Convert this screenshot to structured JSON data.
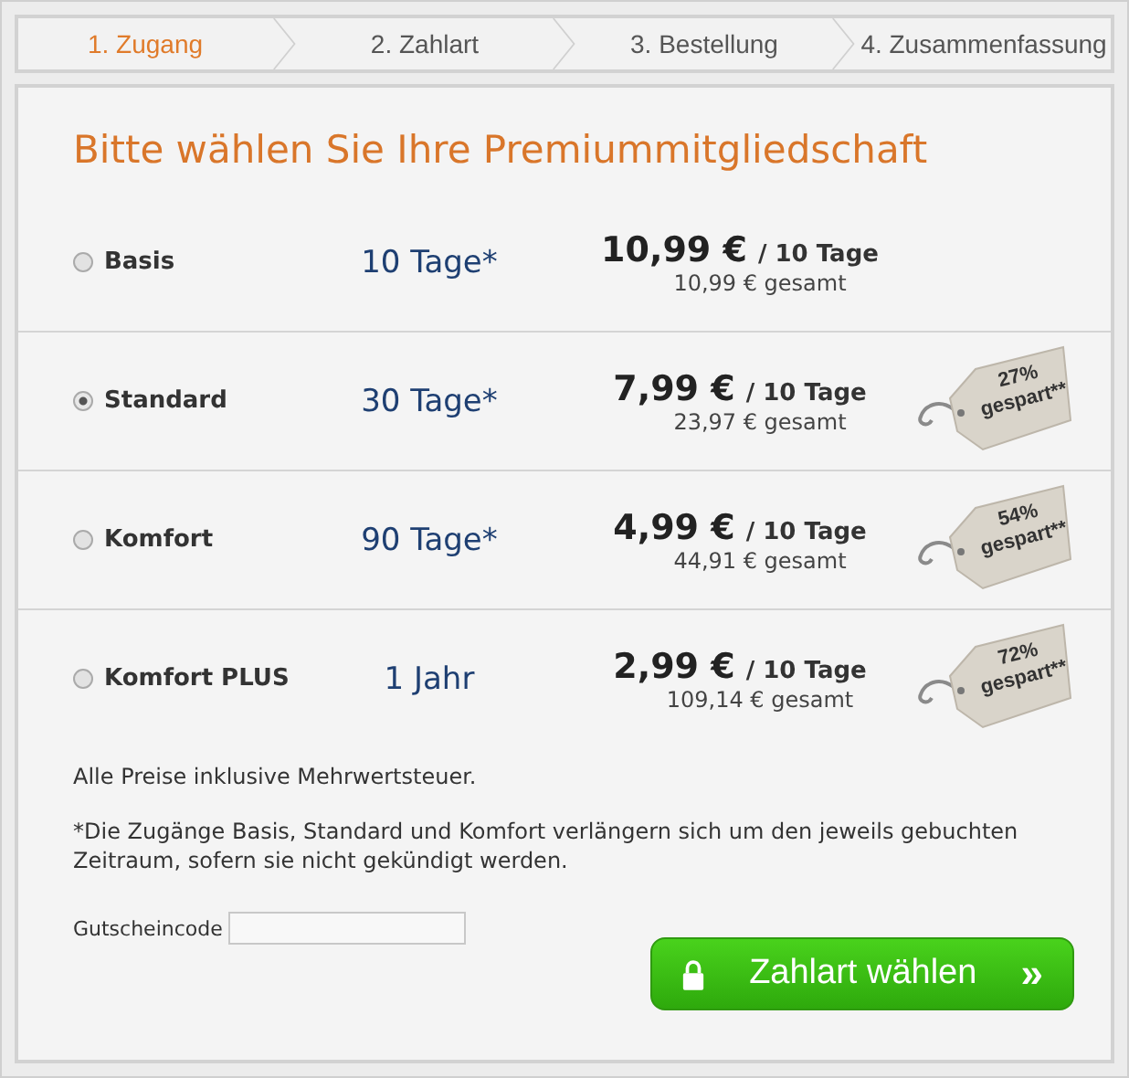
{
  "steps": [
    {
      "label": "1. Zugang",
      "selected": true
    },
    {
      "label": "2. Zahlart",
      "selected": false
    },
    {
      "label": "3. Bestellung",
      "selected": false
    },
    {
      "label": "4. Zusammenfassung",
      "selected": false
    }
  ],
  "title": "Bitte wählen Sie Ihre Premiummitgliedschaft",
  "plans": [
    {
      "name": "Basis",
      "duration": "10 Tage*",
      "price": "10,99 €",
      "per": "/ 10 Tage",
      "total": "10,99 € gesamt",
      "selected": false
    },
    {
      "name": "Standard",
      "duration": "30 Tage*",
      "price": "7,99 €",
      "per": "/ 10 Tage",
      "total": "23,97 € gesamt",
      "selected": true,
      "saving": "27%",
      "saving_label": "gespart**"
    },
    {
      "name": "Komfort",
      "duration": "90 Tage*",
      "price": "4,99 €",
      "per": "/ 10 Tage",
      "total": "44,91 € gesamt",
      "selected": false,
      "saving": "54%",
      "saving_label": "gespart**"
    },
    {
      "name": "Komfort PLUS",
      "duration": "1 Jahr",
      "price": "2,99 €",
      "per": "/ 10 Tage",
      "total": "109,14 € gesamt",
      "selected": false,
      "saving": "72%",
      "saving_label": "gespart**"
    }
  ],
  "notes": [
    "Alle Preise inklusive Mehrwertsteuer.",
    "*Die Zugänge Basis, Standard und Komfort verlängern sich um den jeweils gebuchten Zeitraum, sofern sie nicht gekündigt werden."
  ],
  "voucher": {
    "label": "Gutscheincode"
  },
  "submit": {
    "label": "Zahlart wählen",
    "arrow": "»"
  }
}
